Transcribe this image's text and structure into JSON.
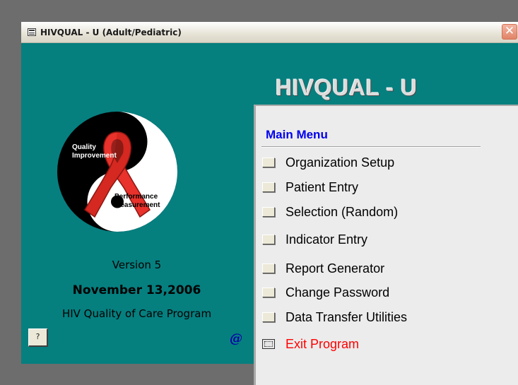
{
  "window": {
    "title": "HIVQUAL - U (Adult/Pediatric)",
    "close_glyph": "✕"
  },
  "header": {
    "app_title": "HIVQUAL - U"
  },
  "logo": {
    "text_quality": "Quality",
    "text_improvement": "Improvement",
    "text_performance": "Performance",
    "text_measurement": "Measurement"
  },
  "info": {
    "version": "Version 5",
    "date": "November 13,2006",
    "program": "HIV Quality of Care Program"
  },
  "help_button": {
    "label": "?"
  },
  "at_icon": {
    "glyph": "@"
  },
  "menu": {
    "heading": "Main Menu",
    "items": [
      {
        "label": "Organization Setup"
      },
      {
        "label": "Patient Entry"
      },
      {
        "label": "Selection (Random)"
      },
      {
        "label": "Indicator Entry"
      },
      {
        "label": "Report Generator"
      },
      {
        "label": "Change Password"
      },
      {
        "label": "Data Transfer Utilities"
      },
      {
        "label": "Exit Program"
      }
    ]
  },
  "colors": {
    "form_background": "#067f7f",
    "menu_heading": "#0000ee",
    "exit_label": "#ff0000",
    "ribbon": "#e8322b"
  }
}
